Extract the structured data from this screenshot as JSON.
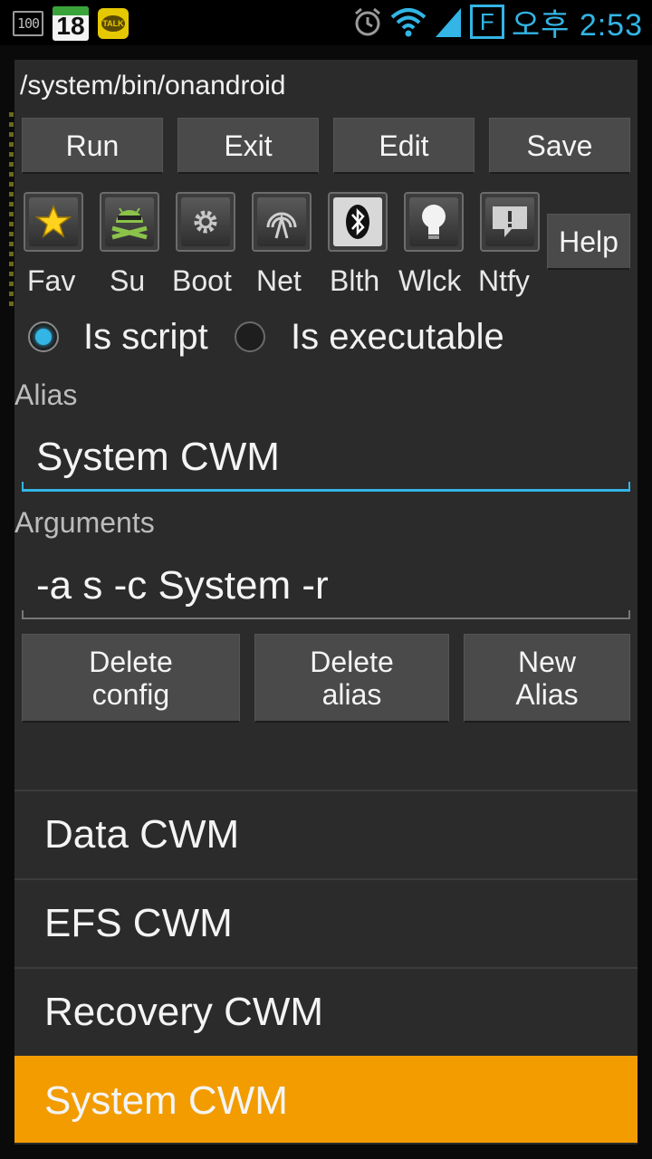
{
  "status_bar": {
    "battery_percent_icon": "100",
    "calendar_day": "18",
    "talk_icon": "TALK",
    "f_icon": "F",
    "time": "오후 2:53",
    "icons": [
      "alarm-icon",
      "wifi-icon",
      "signal-icon"
    ],
    "accent_color": "#33b5e5"
  },
  "dialog": {
    "path": "/system/bin/onandroid",
    "top_buttons": [
      {
        "label": "Run"
      },
      {
        "label": "Exit"
      },
      {
        "label": "Edit"
      },
      {
        "label": "Save"
      }
    ],
    "toggles": [
      {
        "label": "Fav",
        "icon": "star-icon"
      },
      {
        "label": "Su",
        "icon": "superuser-android-icon"
      },
      {
        "label": "Boot",
        "icon": "gear-icon"
      },
      {
        "label": "Net",
        "icon": "network-tower-icon"
      },
      {
        "label": "Blth",
        "icon": "bluetooth-icon"
      },
      {
        "label": "Wlck",
        "icon": "lightbulb-icon"
      },
      {
        "label": "Ntfy",
        "icon": "notification-icon"
      }
    ],
    "help_label": "Help",
    "radio": {
      "script_label": "Is script",
      "executable_label": "Is executable",
      "selected": "Is script"
    },
    "alias": {
      "label": "Alias",
      "value": "System CWM"
    },
    "arguments": {
      "label": "Arguments",
      "value": "-a s -c System -r"
    },
    "action_buttons": [
      {
        "label": "Delete\nconfig"
      },
      {
        "label": "Delete\nalias"
      },
      {
        "label": "New\nAlias"
      }
    ],
    "list": [
      {
        "label": "Data CWM",
        "selected": false
      },
      {
        "label": "EFS CWM",
        "selected": false
      },
      {
        "label": "Recovery CWM",
        "selected": false
      },
      {
        "label": "System CWM",
        "selected": true
      }
    ],
    "selection_color": "#f29c00"
  }
}
